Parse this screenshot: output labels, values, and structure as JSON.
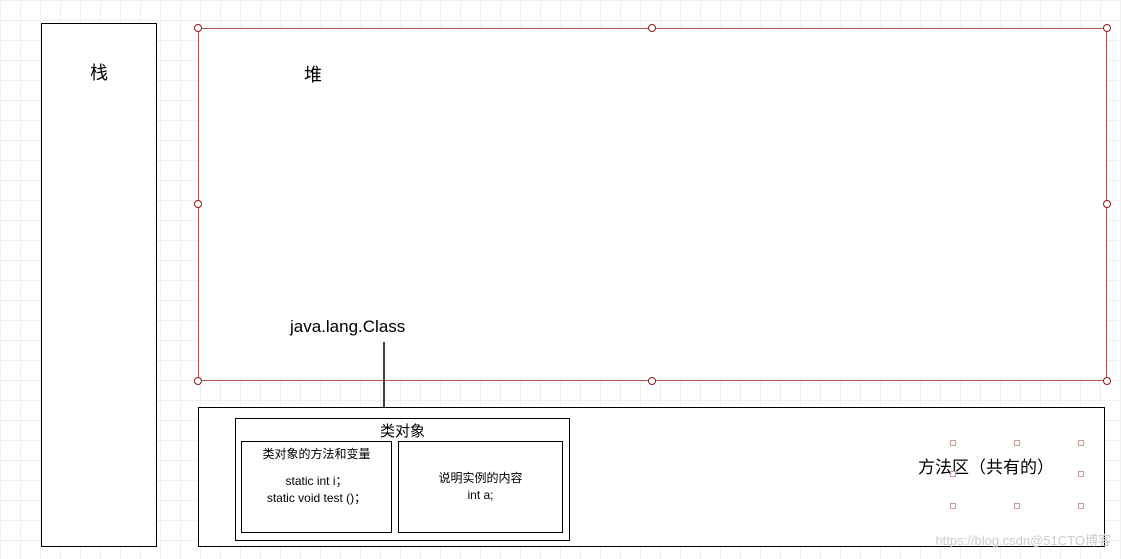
{
  "stack": {
    "label": "栈"
  },
  "heap": {
    "label": "堆"
  },
  "javaLangClass": {
    "label": "java.lang.Class"
  },
  "classObject": {
    "title": "类对象",
    "left": {
      "title": "类对象的方法和变量",
      "code": "static int i；\nstatic void test ()；"
    },
    "right": {
      "title": "说明实例的内容",
      "code": "int a;"
    }
  },
  "methodArea": {
    "label": "方法区（共有的）"
  },
  "watermark": "https://blog.csdn@51CTO博客"
}
